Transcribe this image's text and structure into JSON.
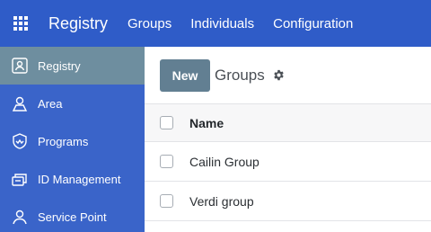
{
  "header": {
    "app_icon": "apps-grid-icon",
    "title": "Registry",
    "nav": [
      "Groups",
      "Individuals",
      "Configuration"
    ],
    "background_color": "#2f5cc8"
  },
  "sidebar": {
    "background_color": "#3a64c9",
    "active_color": "#6e8e9f",
    "items": [
      {
        "label": "Registry",
        "icon": "registry-icon",
        "active": true
      },
      {
        "label": "Area",
        "icon": "area-icon",
        "active": false
      },
      {
        "label": "Programs",
        "icon": "programs-icon",
        "active": false
      },
      {
        "label": "ID Management",
        "icon": "id-management-icon",
        "active": false
      },
      {
        "label": "Service Point",
        "icon": "service-point-icon",
        "active": false
      }
    ]
  },
  "control_panel": {
    "new_label": "New",
    "breadcrumb": "Groups",
    "settings_icon": "gear-icon"
  },
  "table": {
    "columns": [
      "Name"
    ],
    "rows": [
      {
        "name": "Cailin Group"
      },
      {
        "name": "Verdi group"
      }
    ]
  }
}
